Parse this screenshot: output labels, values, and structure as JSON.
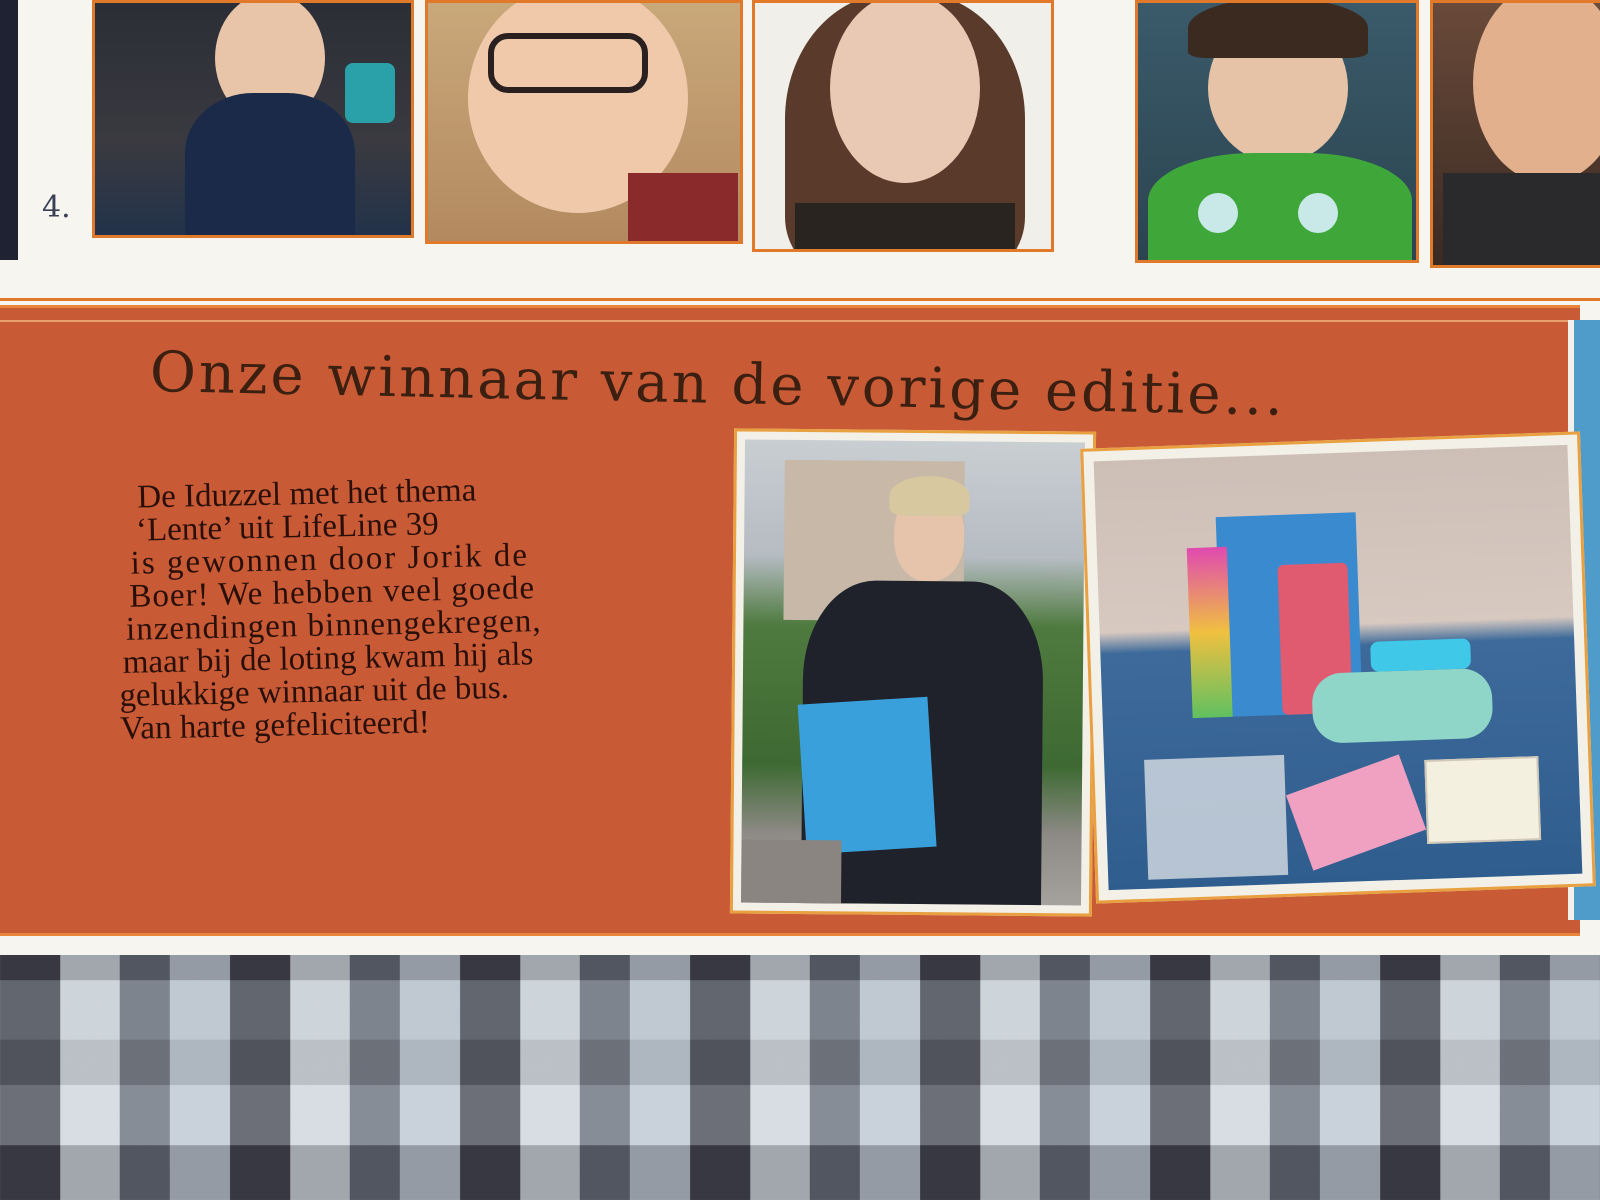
{
  "photo_row": {
    "number_label": "4."
  },
  "banner": {
    "headline": "Onze winnaar van de vorige editie...",
    "body_lines": [
      "De Iduzzel met het thema",
      "‘Lente’ uit LifeLine 39",
      "is gewonnen door Jorik de",
      "Boer!  We hebben veel goede",
      "inzendingen binnengekregen,",
      "maar bij de loting kwam hij als",
      "gelukkige winnaar uit de bus.",
      "Van harte gefeliciteerd!"
    ]
  },
  "colors": {
    "banner_background": "#c85a36",
    "frame_orange": "#e07a2a",
    "headline_text": "#3b1f10"
  }
}
